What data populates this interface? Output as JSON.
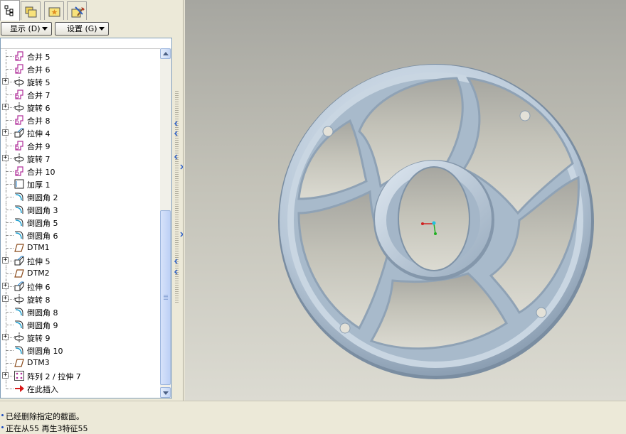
{
  "left_tabs": [
    {
      "name": "model-tree-tab",
      "icon": "model-tree-icon"
    },
    {
      "name": "folder-browser-tab",
      "icon": "folder-icon"
    },
    {
      "name": "favorites-tab",
      "icon": "favorites-icon"
    },
    {
      "name": "connections-tab",
      "icon": "tools-icon"
    }
  ],
  "toolbar": {
    "display_label": "显示 (D)",
    "settings_label": "设置 (G)"
  },
  "tree": [
    {
      "label": "合并 5",
      "type": "merge",
      "expand": false
    },
    {
      "label": "合并 6",
      "type": "merge",
      "expand": false
    },
    {
      "label": "旋转 5",
      "type": "revolve",
      "expand": true
    },
    {
      "label": "合并 7",
      "type": "merge",
      "expand": false
    },
    {
      "label": "旋转 6",
      "type": "revolve",
      "expand": true
    },
    {
      "label": "合并 8",
      "type": "merge",
      "expand": false
    },
    {
      "label": "拉伸 4",
      "type": "extrude",
      "expand": true
    },
    {
      "label": "合并 9",
      "type": "merge",
      "expand": false
    },
    {
      "label": "旋转 7",
      "type": "revolve",
      "expand": true
    },
    {
      "label": "合并 10",
      "type": "merge",
      "expand": false
    },
    {
      "label": "加厚 1",
      "type": "thicken",
      "expand": false
    },
    {
      "label": "倒圆角 2",
      "type": "round",
      "expand": false
    },
    {
      "label": "倒圆角 3",
      "type": "round",
      "expand": false
    },
    {
      "label": "倒圆角 5",
      "type": "round",
      "expand": false
    },
    {
      "label": "倒圆角 6",
      "type": "round",
      "expand": false
    },
    {
      "label": "DTM1",
      "type": "datum",
      "expand": false
    },
    {
      "label": "拉伸 5",
      "type": "extrude",
      "expand": true
    },
    {
      "label": "DTM2",
      "type": "datum",
      "expand": false
    },
    {
      "label": "拉伸 6",
      "type": "extrude",
      "expand": true
    },
    {
      "label": "旋转 8",
      "type": "revolve",
      "expand": true
    },
    {
      "label": "倒圆角 8",
      "type": "round",
      "expand": false
    },
    {
      "label": "倒圆角 9",
      "type": "round",
      "expand": false
    },
    {
      "label": "旋转 9",
      "type": "revolve",
      "expand": true
    },
    {
      "label": "倒圆角 10",
      "type": "round",
      "expand": false
    },
    {
      "label": "DTM3",
      "type": "datum",
      "expand": false
    },
    {
      "label": "阵列 2 / 拉伸 7",
      "type": "pattern",
      "expand": true
    },
    {
      "label": "在此插入",
      "type": "insert",
      "expand": false
    }
  ],
  "messages": [
    "已经删除指定的截面。",
    "正在从55 再生3特征55"
  ],
  "colors": {
    "accent": "#2b5ec7",
    "model": "#b9c9d8",
    "viewport_top": "#a6a6a0",
    "viewport_bottom": "#dcdbd2"
  }
}
